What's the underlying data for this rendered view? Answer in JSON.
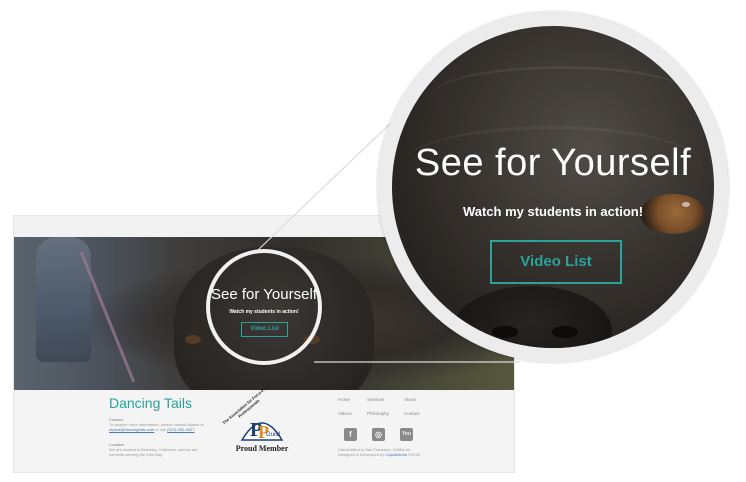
{
  "hero": {
    "title": "See for Yourself",
    "subtitle": "Watch my students in action!",
    "button_label": "Video List"
  },
  "footer": {
    "brand": "Dancing Tails",
    "contact_heading": "Contact",
    "contact_text": "To acquire more information, please contact Alyssa at",
    "contact_email": "alyssa@dancingtails.com",
    "contact_phone_prefix": "or call",
    "contact_phone": "(510) 402-4927",
    "location_heading": "Location",
    "location_text": "We are located in Berkeley, California, and we are currently serving the East Bay.",
    "guild": {
      "arc_text": "The Association for Force-Free Professionals",
      "logo_letters": "PP",
      "logo_word": "Guild",
      "proud_member": "Proud Member"
    },
    "nav": {
      "home": "Home",
      "services": "Services",
      "about": "About",
      "videos": "Videos",
      "philosophy": "Philosophy",
      "contact": "Contact"
    },
    "social": {
      "facebook": "f",
      "instagram": "◎",
      "youtube": "You"
    },
    "credits_line1": "Handcrafted in San Francisco, California.",
    "credits_line2_prefix": "Designed & Developed by",
    "credits_designer": "LiquidMedia",
    "credits_year": "©2016"
  },
  "colors": {
    "accent": "#2aa39a",
    "footer_bg": "#f4f4f4",
    "ring": "#ececec"
  }
}
